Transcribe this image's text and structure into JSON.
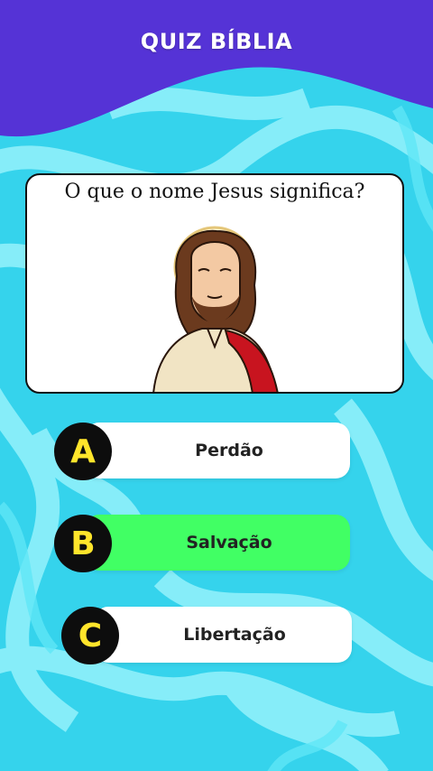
{
  "header": {
    "title": "QUIZ BÍBLIA"
  },
  "question": {
    "text": "O que o nome Jesus significa?",
    "image": "jesus-illustration"
  },
  "options": [
    {
      "letter": "A",
      "label": "Perdão",
      "selected": false
    },
    {
      "letter": "B",
      "label": "Salvação",
      "selected": true
    },
    {
      "letter": "C",
      "label": "Libertação",
      "selected": false
    }
  ],
  "colors": {
    "header": "#5533d6",
    "background": "#35d3ec",
    "correct": "#41ff64",
    "badge": "#0d0d0d",
    "badge_letter": "#ffe52b"
  }
}
